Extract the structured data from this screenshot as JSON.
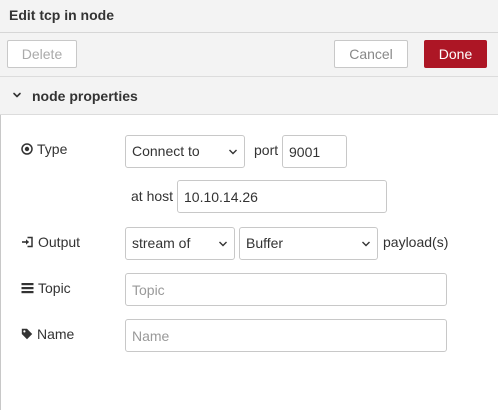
{
  "window": {
    "title": "Edit tcp in node"
  },
  "toolbar": {
    "delete_label": "Delete",
    "cancel_label": "Cancel",
    "done_label": "Done"
  },
  "section": {
    "title": "node properties",
    "icon": "chevron-down-icon"
  },
  "form": {
    "type": {
      "label": "Type",
      "icon": "radio-target-icon",
      "selected": "Connect to"
    },
    "port": {
      "label": "port",
      "value": "9001"
    },
    "host": {
      "label": "at host",
      "value": "10.10.14.26"
    },
    "output": {
      "label": "Output",
      "icon": "sign-in-icon",
      "mode_selected": "stream of",
      "format_selected": "Buffer",
      "suffix": "payload(s)"
    },
    "topic": {
      "label": "Topic",
      "icon": "tasks-icon",
      "value": "",
      "placeholder": "Topic"
    },
    "name": {
      "label": "Name",
      "icon": "tag-icon",
      "value": "",
      "placeholder": "Name"
    }
  },
  "colors": {
    "accent": "#ad1625",
    "panel_bg": "#f3f3f3",
    "border": "#c8c8c8"
  }
}
